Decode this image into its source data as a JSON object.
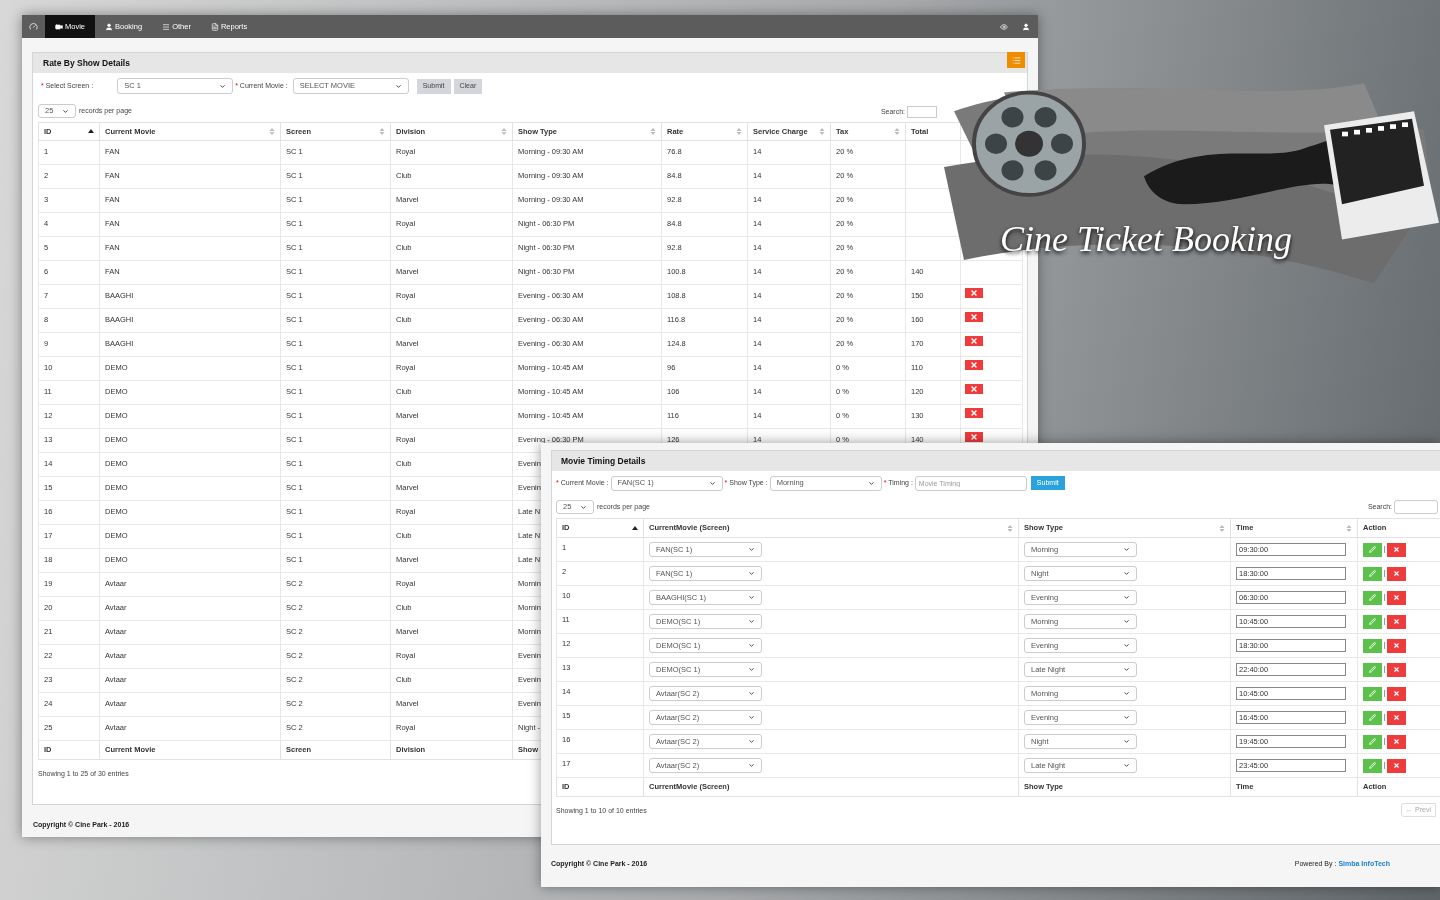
{
  "main_window": {
    "nav": {
      "items": [
        {
          "label": "Movie",
          "selected": true
        },
        {
          "label": "Booking",
          "selected": false
        },
        {
          "label": "Other",
          "selected": false
        },
        {
          "label": "Reports",
          "selected": false
        }
      ]
    },
    "panel_title": "Rate By Show Details",
    "form": {
      "fields": [
        {
          "mark": "*",
          "label": "Select Screen :",
          "value": "SC 1"
        },
        {
          "mark": "*",
          "label": "Current Movie :",
          "value": "SELECT MOVIE"
        }
      ],
      "buttons": [
        "Submit",
        "Clear"
      ]
    },
    "page_size": "25",
    "page_size_label": "records per page",
    "search_label": "Search:",
    "table": {
      "columns": [
        {
          "label": "ID",
          "sortable": true,
          "sorted": true
        },
        {
          "label": "Current Movie",
          "sortable": true,
          "sorted": false
        },
        {
          "label": "Screen",
          "sortable": true,
          "sorted": false
        },
        {
          "label": "Division",
          "sortable": true,
          "sorted": false
        },
        {
          "label": "Show Type",
          "sortable": true,
          "sorted": false
        },
        {
          "label": "Rate",
          "sortable": true,
          "sorted": false
        },
        {
          "label": "Service Charge",
          "sortable": true,
          "sorted": false
        },
        {
          "label": "Tax",
          "sortable": true,
          "sorted": false
        },
        {
          "label": "Total",
          "sortable": false
        }
      ],
      "rows": [
        {
          "id": "1",
          "movie": "FAN",
          "screen": "SC 1",
          "division": "Royal",
          "show_type": "Morning - 09:30 AM",
          "rate": "76.8",
          "service_charge": "14",
          "tax": "20 %",
          "delete_button": false
        },
        {
          "id": "2",
          "movie": "FAN",
          "screen": "SC 1",
          "division": "Club",
          "show_type": "Morning - 09:30 AM",
          "rate": "84.8",
          "service_charge": "14",
          "tax": "20 %",
          "delete_button": false
        },
        {
          "id": "3",
          "movie": "FAN",
          "screen": "SC 1",
          "division": "Marvel",
          "show_type": "Morning - 09:30 AM",
          "rate": "92.8",
          "service_charge": "14",
          "tax": "20 %",
          "delete_button": false
        },
        {
          "id": "4",
          "movie": "FAN",
          "screen": "SC 1",
          "division": "Royal",
          "show_type": "Night - 06:30 PM",
          "rate": "84.8",
          "service_charge": "14",
          "tax": "20 %",
          "delete_button": false
        },
        {
          "id": "5",
          "movie": "FAN",
          "screen": "SC 1",
          "division": "Club",
          "show_type": "Night - 06:30 PM",
          "rate": "92.8",
          "service_charge": "14",
          "tax": "20 %",
          "delete_button": false
        },
        {
          "id": "6",
          "movie": "FAN",
          "screen": "SC 1",
          "division": "Marvel",
          "show_type": "Night - 06:30 PM",
          "rate": "100.8",
          "service_charge": "14",
          "tax": "20 %",
          "total": "140",
          "delete_button": false
        },
        {
          "id": "7",
          "movie": "BAAGHI",
          "screen": "SC 1",
          "division": "Royal",
          "show_type": "Evening - 06:30 AM",
          "rate": "108.8",
          "service_charge": "14",
          "tax": "20 %",
          "total": "150",
          "delete_button": true
        },
        {
          "id": "8",
          "movie": "BAAGHI",
          "screen": "SC 1",
          "division": "Club",
          "show_type": "Evening - 06:30 AM",
          "rate": "116.8",
          "service_charge": "14",
          "tax": "20 %",
          "total": "160",
          "delete_button": true
        },
        {
          "id": "9",
          "movie": "BAAGHI",
          "screen": "SC 1",
          "division": "Marvel",
          "show_type": "Evening - 06:30 AM",
          "rate": "124.8",
          "service_charge": "14",
          "tax": "20 %",
          "total": "170",
          "delete_button": true
        },
        {
          "id": "10",
          "movie": "DEMO",
          "screen": "SC 1",
          "division": "Royal",
          "show_type": "Morning - 10:45 AM",
          "rate": "96",
          "service_charge": "14",
          "tax": "0 %",
          "total": "110",
          "delete_button": true
        },
        {
          "id": "11",
          "movie": "DEMO",
          "screen": "SC 1",
          "division": "Club",
          "show_type": "Morning - 10:45 AM",
          "rate": "106",
          "service_charge": "14",
          "tax": "0 %",
          "total": "120",
          "delete_button": true
        },
        {
          "id": "12",
          "movie": "DEMO",
          "screen": "SC 1",
          "division": "Marvel",
          "show_type": "Morning - 10:45 AM",
          "rate": "116",
          "service_charge": "14",
          "tax": "0 %",
          "total": "130",
          "delete_button": true
        },
        {
          "id": "13",
          "movie": "DEMO",
          "screen": "SC 1",
          "division": "Royal",
          "show_type": "Evening - 06:30 PM",
          "rate": "126",
          "service_charge": "14",
          "tax": "0 %",
          "total": "140",
          "delete_button": true
        },
        {
          "id": "14",
          "movie": "DEMO",
          "screen": "SC 1",
          "division": "Club",
          "show_type": "Evenin",
          "delete_button": false
        },
        {
          "id": "15",
          "movie": "DEMO",
          "screen": "SC 1",
          "division": "Marvel",
          "show_type": "Evenin",
          "delete_button": false
        },
        {
          "id": "16",
          "movie": "DEMO",
          "screen": "SC 1",
          "division": "Royal",
          "show_type": "Late N",
          "delete_button": false
        },
        {
          "id": "17",
          "movie": "DEMO",
          "screen": "SC 1",
          "division": "Club",
          "show_type": "Late N",
          "delete_button": false
        },
        {
          "id": "18",
          "movie": "DEMO",
          "screen": "SC 1",
          "division": "Marvel",
          "show_type": "Late N",
          "delete_button": false
        },
        {
          "id": "19",
          "movie": "Avtaar",
          "screen": "SC 2",
          "division": "Royal",
          "show_type": "Mornin",
          "delete_button": false
        },
        {
          "id": "20",
          "movie": "Avtaar",
          "screen": "SC 2",
          "division": "Club",
          "show_type": "Mornin",
          "delete_button": false
        },
        {
          "id": "21",
          "movie": "Avtaar",
          "screen": "SC 2",
          "division": "Marvel",
          "show_type": "Mornin",
          "delete_button": false
        },
        {
          "id": "22",
          "movie": "Avtaar",
          "screen": "SC 2",
          "division": "Royal",
          "show_type": "Evenin",
          "delete_button": false
        },
        {
          "id": "23",
          "movie": "Avtaar",
          "screen": "SC 2",
          "division": "Club",
          "show_type": "Evenin",
          "delete_button": false
        },
        {
          "id": "24",
          "movie": "Avtaar",
          "screen": "SC 2",
          "division": "Marvel",
          "show_type": "Evenin",
          "delete_button": false
        },
        {
          "id": "25",
          "movie": "Avtaar",
          "screen": "SC 2",
          "division": "Royal",
          "show_type": "Night -",
          "delete_button": false
        }
      ],
      "footer_columns": [
        "ID",
        "Current Movie",
        "Screen",
        "Division",
        "Show"
      ]
    },
    "summary": "Showing 1 to 25 of 30 entries",
    "copyright": "Copyright © Cine Park - 2016"
  },
  "logo": {
    "title": "Cine Ticket Booking"
  },
  "timing_window": {
    "panel_title": "Movie Timing Details",
    "form": {
      "fields": [
        {
          "kind": "select",
          "mark": "*",
          "label": "Current Movie :",
          "value": "FAN(SC 1)"
        },
        {
          "kind": "select",
          "mark": "*",
          "label": "Show Type :",
          "value": "Morning"
        },
        {
          "kind": "input",
          "mark": "*",
          "label": "Timing :",
          "placeholder": "Movie Timing"
        }
      ],
      "button": "Submit"
    },
    "page_size": "25",
    "page_size_label": "records per page",
    "search_label": "Search:",
    "table": {
      "columns": [
        {
          "label": "ID",
          "sortable": true,
          "sorted": true
        },
        {
          "label": "CurrentMovie (Screen)",
          "sortable": true,
          "sorted": false
        },
        {
          "label": "Show Type",
          "sortable": true,
          "sorted": false
        },
        {
          "label": "Time",
          "sortable": true,
          "sorted": false
        },
        {
          "label": "Action",
          "sortable": false
        }
      ],
      "rows": [
        {
          "id": "1",
          "movie": "FAN(SC 1)",
          "show_type": "Morning",
          "time": "09:30:00"
        },
        {
          "id": "2",
          "movie": "FAN(SC 1)",
          "show_type": "Night",
          "time": "18:30:00"
        },
        {
          "id": "10",
          "movie": "BAAGHI(SC 1)",
          "show_type": "Evening",
          "time": "06:30:00"
        },
        {
          "id": "11",
          "movie": "DEMO(SC 1)",
          "show_type": "Morning",
          "time": "10:45:00"
        },
        {
          "id": "12",
          "movie": "DEMO(SC 1)",
          "show_type": "Evening",
          "time": "18:30:00"
        },
        {
          "id": "13",
          "movie": "DEMO(SC 1)",
          "show_type": "Late Night",
          "time": "22:40:00"
        },
        {
          "id": "14",
          "movie": "Avtaar(SC 2)",
          "show_type": "Morning",
          "time": "10:45:00"
        },
        {
          "id": "15",
          "movie": "Avtaar(SC 2)",
          "show_type": "Evening",
          "time": "16:45:00"
        },
        {
          "id": "16",
          "movie": "Avtaar(SC 2)",
          "show_type": "Night",
          "time": "19:45:00"
        },
        {
          "id": "17",
          "movie": "Avtaar(SC 2)",
          "show_type": "Late Night",
          "time": "23:45:00"
        }
      ],
      "footer_columns": [
        "ID",
        "CurrentMovie (Screen)",
        "Show Type",
        "Time",
        "Action"
      ]
    },
    "summary": "Showing 1 to 10 of 10 entries",
    "pager_button": "← Previ",
    "copyright": "Copyright © Cine Park - 2016",
    "powered_by": "Powered By :",
    "powered_by_link": "Simba InfoTech"
  }
}
